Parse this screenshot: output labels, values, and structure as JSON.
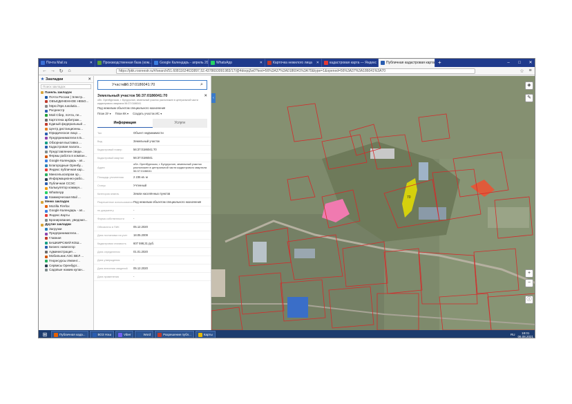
{
  "browser": {
    "tabs": [
      {
        "label": "Почта Mail.ru",
        "color": "#3b6fd6",
        "active": false
      },
      {
        "label": "Производственная база (ком...",
        "color": "#5a9e3a",
        "active": false
      },
      {
        "label": "Google Календарь - апрель 20...",
        "color": "#3b7de0",
        "active": false
      },
      {
        "label": "WhatsApp",
        "color": "#25d366",
        "active": false
      },
      {
        "label": "Карточка нежилого лица",
        "color": "#c0392b",
        "active": false
      },
      {
        "label": "кадастровая карта — Яндекс",
        "color": "#e53935",
        "active": false
      },
      {
        "label": "Публичная кадастровая карта",
        "color": "#2a5db0",
        "active": true
      }
    ],
    "url": "https://pkk.rosreestr.ru/#/search/51.60811624633897,52.4378693091983/17/@4doqq2w0?text=56%3A37%3A0186041%3A70&type=1&opened=56%3A37%3A186041%3A70"
  },
  "bookmarks": {
    "title": "Закладки",
    "search_placeholder": "Поиск закладок",
    "items": [
      {
        "label": "Панель закладок",
        "folder": true,
        "color": "#d9a53a"
      },
      {
        "label": "Почта России | Электр...",
        "color": "#1c57a6"
      },
      {
        "label": "ОБЪЕДИНЕННОЕ НЕБО...",
        "color": "#c0392b"
      },
      {
        "label": "https://rtps.rusolutio...",
        "color": "#888888"
      },
      {
        "label": "Росреестр",
        "color": "#2a5db0"
      },
      {
        "label": "Мой Сбер, почта, пе...",
        "color": "#21a038"
      },
      {
        "label": "Картотека арбитраж...",
        "color": "#6b6b6b"
      },
      {
        "label": "Единый федеральный ...",
        "color": "#c0392b"
      },
      {
        "label": "Центр дистанционны...",
        "color": "#e67e22"
      },
      {
        "label": "Юридическое лицо ...",
        "color": "#2a5db0"
      },
      {
        "label": "Предприниматели в Б...",
        "color": "#8e44ad"
      },
      {
        "label": "Обзорная выставка ...",
        "color": "#16a085"
      },
      {
        "label": "Кадастровая палата...",
        "color": "#2a5db0"
      },
      {
        "label": "Представление сведе...",
        "color": "#7f8c8d"
      },
      {
        "label": "Фермы работа в компан...",
        "color": "#d35400"
      },
      {
        "label": "Google Календарь - ап...",
        "color": "#3b7de0"
      },
      {
        "label": "Благородные Оренбу...",
        "color": "#2980b9"
      },
      {
        "label": "Яндекс публичная кар...",
        "color": "#e53935"
      },
      {
        "label": "Минсельхозпром ор...",
        "color": "#27ae60"
      },
      {
        "label": "Информационно-рабо...",
        "color": "#2c3e50"
      },
      {
        "label": "Публичная ССЭС",
        "color": "#2a5db0"
      },
      {
        "label": "Калькулятор коммун...",
        "color": "#f39c12"
      },
      {
        "label": "WhatsApp",
        "color": "#25d366"
      },
      {
        "label": "Коммерческая Mail ...",
        "color": "#3b6fd6"
      },
      {
        "label": "Меню закладок",
        "folder": true,
        "color": "#d9a53a"
      },
      {
        "label": "Mozilla Firefox",
        "color": "#e66000"
      },
      {
        "label": "Google Календарь - ап...",
        "color": "#3b7de0"
      },
      {
        "label": "Яндекс.Карты",
        "color": "#e53935"
      },
      {
        "label": "Бронирование, уведомл...",
        "color": "#7f8c8d"
      },
      {
        "label": "Другие закладки",
        "folder": true,
        "color": "#d9a53a"
      },
      {
        "label": "Загрузки",
        "color": "#2980b9"
      },
      {
        "label": "Предприниматели...",
        "color": "#8e44ad"
      },
      {
        "label": "Главная",
        "color": "#c0392b"
      },
      {
        "label": "БАШКИРСКИЙ КОШ...",
        "color": "#16a085"
      },
      {
        "label": "Бизнес навигатор",
        "color": "#2a5db0"
      },
      {
        "label": "Администрация ...",
        "color": "#6b6b6b"
      },
      {
        "label": "Мобильник АЭС ВЕЛ ...",
        "color": "#d35400"
      },
      {
        "label": "Георесурсы Инвент...",
        "color": "#27ae60"
      },
      {
        "label": "Сервисы Оренбург...",
        "color": "#2c3e50"
      },
      {
        "label": "Садовые нажим купан...",
        "color": "#7f8c8d"
      }
    ]
  },
  "card": {
    "search_type": "Участки",
    "search_value": "56:37:0186041:70",
    "title": "Земельный участок 56:37:0186041:70",
    "subtitle": "обл. Оренбургская, г. Бугуруслан, земельный участок расположен в центральной части кадастрового квартала 56:37:0186041",
    "note": "Под нежилым объектом специального назначения",
    "tools": [
      "План ЗУ",
      "План КК",
      "Создать участок ИС"
    ],
    "tab_info": "Информация",
    "tab_services": "Услуги",
    "rows": [
      {
        "k": "Тип",
        "v": "Объект недвижимости"
      },
      {
        "k": "Вид",
        "v": "Земельный участок"
      },
      {
        "k": "Кадастровый номер",
        "v": "56:37:0186041:70"
      },
      {
        "k": "Кадастровый квартал",
        "v": "56:37:0186041"
      },
      {
        "k": "Адрес",
        "v": "обл. Оренбургская, г. Бугуруслан, земельный участок расположен в центральной части кадастрового квартала 56:37:0186041"
      },
      {
        "k": "Площадь уточненная",
        "v": "2 235 кв. м"
      },
      {
        "k": "Статус",
        "v": "Учтенный"
      },
      {
        "k": "Категория земель",
        "v": "Земли населённых пунктов"
      },
      {
        "k": "Разрешенное использование",
        "v": "Под нежилым объектом специального назначения"
      },
      {
        "k": "по документу",
        "v": "-"
      },
      {
        "k": "Форма собственности",
        "v": "-"
      },
      {
        "k": "Обновлено в ПИК",
        "v": "05.12.2020"
      },
      {
        "k": "Дата постановки на учет",
        "v": "18.05.2009"
      },
      {
        "k": "Кадастровая стоимость",
        "v": "607 598,31 руб."
      },
      {
        "k": "Дата определения",
        "v": "01.01.2020"
      },
      {
        "k": "Дата утверждения",
        "v": "-"
      },
      {
        "k": "Дата внесения сведений",
        "v": "05.12.2020"
      },
      {
        "k": "Дата применения",
        "v": "-"
      }
    ]
  },
  "map": {
    "plot_label": "70",
    "parcel_color": "#e8e000",
    "boundary_color": "#d42a2a",
    "building_color": "#f07ab0"
  },
  "taskbar": {
    "items": [
      {
        "label": "Публичная када...",
        "color": "#e66000"
      },
      {
        "label": "ВОЗ Нэш",
        "color": "#2a5db0"
      },
      {
        "label": "Viber",
        "color": "#7360f2"
      },
      {
        "label": "Word",
        "color": "#2b579a"
      },
      {
        "label": "Разрешение публ...",
        "color": "#c0392b"
      },
      {
        "label": "Карты",
        "color": "#e6b800"
      }
    ],
    "lang": "RU",
    "time": "18:01",
    "date": "06.08.2021"
  }
}
